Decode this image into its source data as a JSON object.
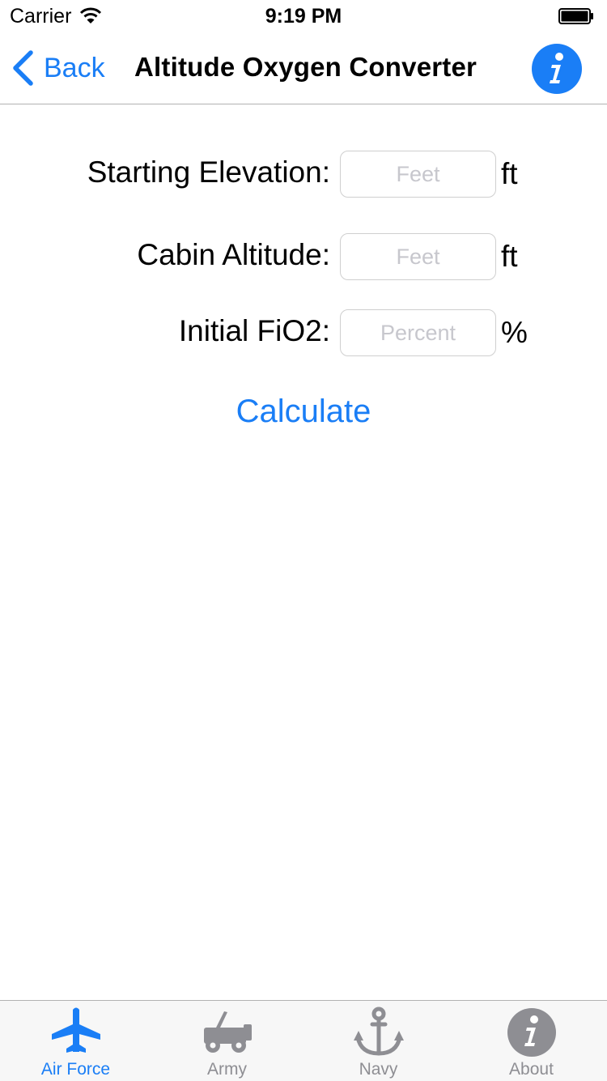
{
  "status_bar": {
    "carrier": "Carrier",
    "time": "9:19 PM"
  },
  "nav": {
    "back_label": "Back",
    "title": "Altitude Oxygen Converter",
    "info_icon": "info-icon"
  },
  "form": {
    "rows": [
      {
        "label": "Starting Elevation:",
        "placeholder": "Feet",
        "value": "",
        "unit": "ft"
      },
      {
        "label": "Cabin Altitude:",
        "placeholder": "Feet",
        "value": "",
        "unit": "ft"
      },
      {
        "label": "Initial FiO2:",
        "placeholder": "Percent",
        "value": "",
        "unit": "%"
      }
    ],
    "calculate_label": "Calculate"
  },
  "tabs": [
    {
      "label": "Air Force",
      "icon": "airplane-icon",
      "active": true
    },
    {
      "label": "Army",
      "icon": "jeep-icon",
      "active": false
    },
    {
      "label": "Navy",
      "icon": "anchor-icon",
      "active": false
    },
    {
      "label": "About",
      "icon": "info-icon",
      "active": false
    }
  ],
  "colors": {
    "accent": "#1a7ef6",
    "inactive": "#8e8e93",
    "tab_bar_bg": "#f7f7f7"
  }
}
